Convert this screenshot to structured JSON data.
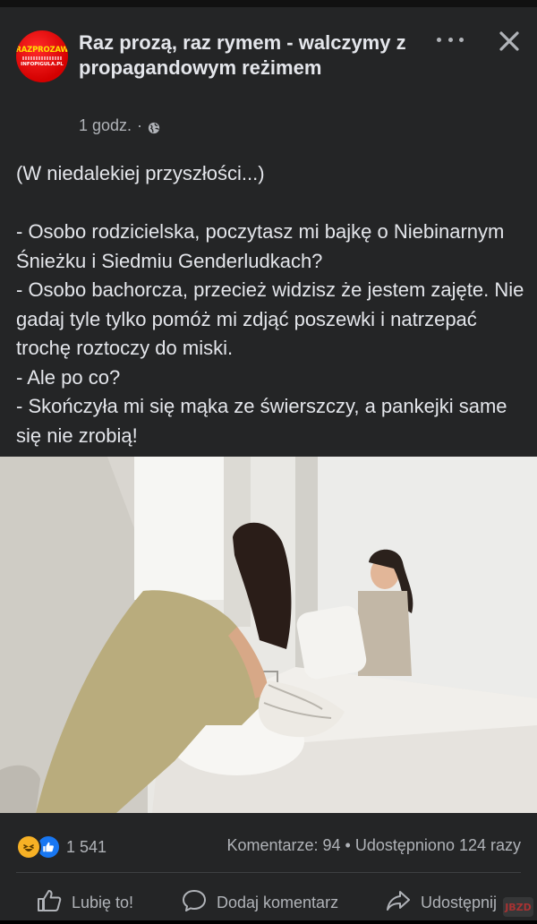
{
  "post": {
    "page_name": "Raz prozą, raz rymem - walczymy z propagandowym reżimem",
    "avatar": {
      "line1": "RAZPROZAW",
      "line3": "INFOPIGULA.PL"
    },
    "time": "1 godz.",
    "separator": "·",
    "privacy_icon": "globe-icon",
    "text": {
      "line1": "(W niedalekiej przyszłości...)",
      "line2": "- Osobo rodzicielska, poczytasz mi bajkę o Niebinarnym Śnieżku i Siedmiu Genderludkach?",
      "line3": "- Osobo bachorcza, przecież widzisz że jestem zajęte. Nie gadaj tyle tylko pomóż mi zdjąć poszewki i natrzepać trochę roztoczy do miski.",
      "line4": "- Ale po co?",
      "line5": "- Skończyła mi się mąka ze świerszczy, a pankejki same się nie zrobią!"
    }
  },
  "stats": {
    "reactions": [
      "haha-icon",
      "like-icon"
    ],
    "reaction_count": "1 541",
    "comments": "Komentarze: 94",
    "dot": "•",
    "shares": "Udostępniono 124 razy"
  },
  "actions": {
    "like": "Lubię to!",
    "comment": "Dodaj komentarz",
    "share": "Udostępnij"
  },
  "colors": {
    "card_bg": "#242526",
    "text": "#e4e6eb",
    "secondary_text": "#b0b3b8",
    "like_blue": "#1877f2",
    "haha_yellow": "#f7b125"
  }
}
